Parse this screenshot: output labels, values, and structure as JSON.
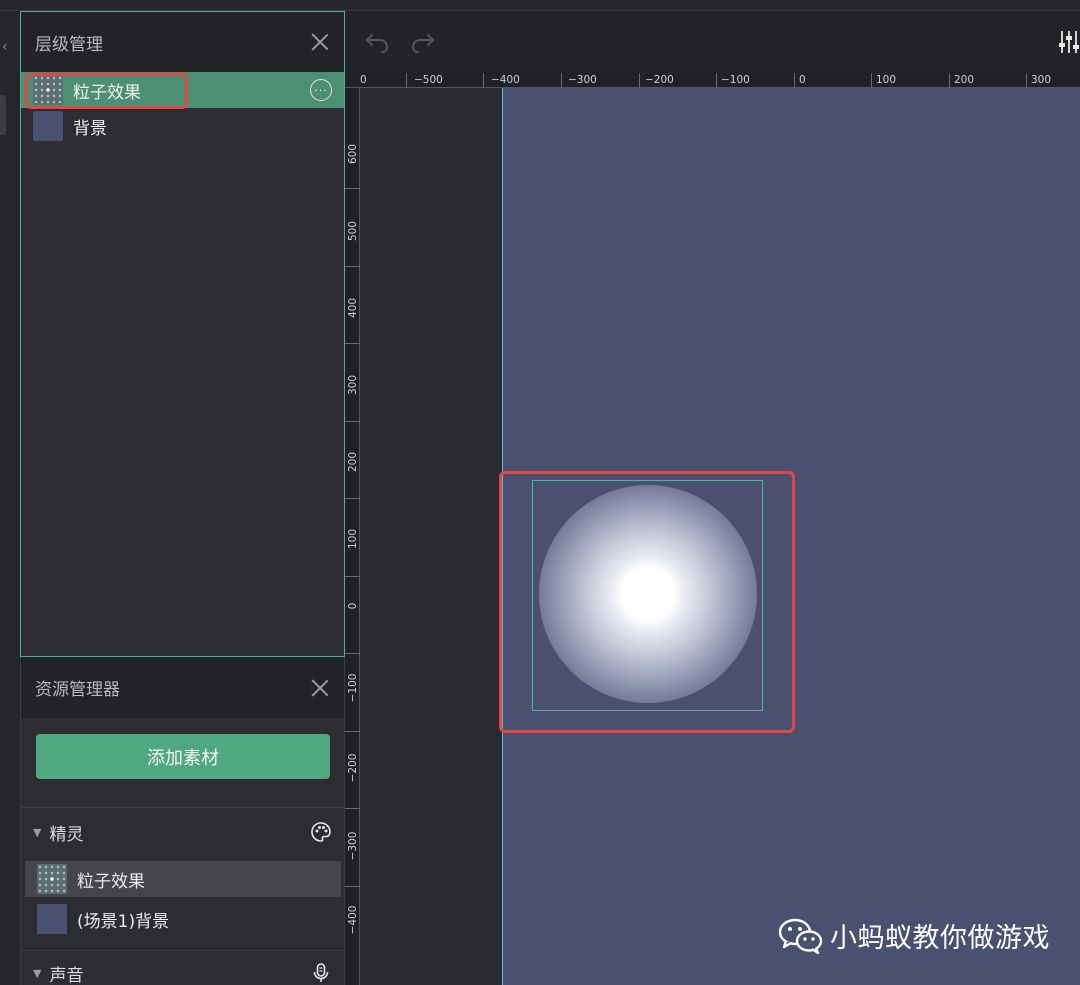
{
  "hierarchy": {
    "title": "层级管理",
    "layers": [
      {
        "label": "粒子效果",
        "icon": "particles-thumbnail",
        "selected": true
      },
      {
        "label": "背景",
        "icon": "background-thumbnail",
        "selected": false
      }
    ]
  },
  "resources": {
    "title": "资源管理器",
    "add_button": "添加素材",
    "sections": [
      {
        "title": "精灵",
        "icon": "palette-icon",
        "items": [
          {
            "label": "粒子效果",
            "icon": "particles-thumbnail",
            "highlighted": true
          },
          {
            "label": "(场景1)背景",
            "icon": "background-thumbnail",
            "highlighted": false
          }
        ]
      },
      {
        "title": "声音",
        "icon": "microphone-icon",
        "items": []
      }
    ]
  },
  "toolbar": {
    "undo_icon": "undo-icon",
    "redo_icon": "redo-icon",
    "settings_icon": "sliders-icon"
  },
  "ruler": {
    "top_labels": [
      "0",
      "−500",
      "−400",
      "−300",
      "−200",
      "−100",
      "0",
      "100",
      "200",
      "300"
    ],
    "left_labels": [
      "600",
      "500",
      "400",
      "300",
      "200",
      "100",
      "0",
      "−100",
      "−200",
      "−300",
      "−400"
    ]
  },
  "watermark": {
    "text": "小蚂蚁教你做游戏",
    "icon": "wechat-icon"
  },
  "colors": {
    "accent": "#4fa882",
    "selection": "#4b8f74",
    "highlight_red": "#e04848",
    "stage": "#4a5070"
  }
}
